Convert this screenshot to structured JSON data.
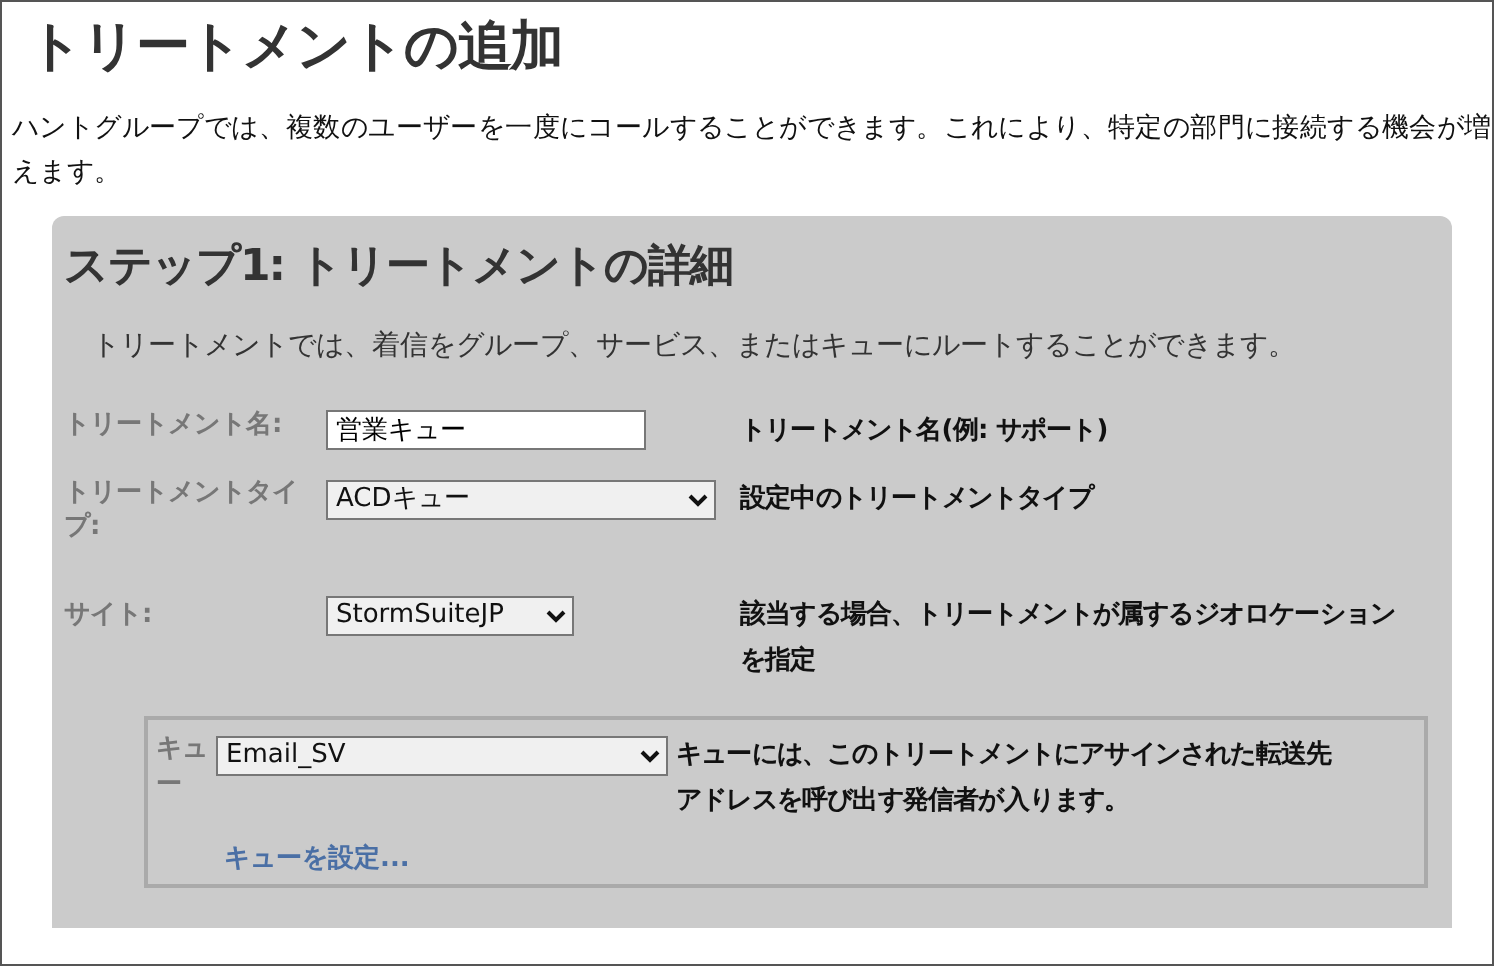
{
  "page_title": "トリートメントの追加",
  "intro": "ハントグループでは、複数のユーザーを一度にコールすることができます。これにより、特定の部門に接続する機会が増えます。",
  "step": {
    "title": "ステップ1: トリートメントの詳細",
    "description": "トリートメントでは、着信をグループ、サービス、またはキューにルートすることができます。",
    "fields": [
      {
        "kind": "text",
        "label": "トリートメント名:",
        "value": "営業キュー",
        "help": "トリートメント名(例: サポート)"
      },
      {
        "kind": "select",
        "label": "トリートメントタイプ:",
        "value": "ACDキュー",
        "help": "設定中のトリートメントタイプ"
      },
      {
        "kind": "select",
        "label": "サイト:",
        "value": "StormSuiteJP",
        "help": "該当する場合、トリートメントが属するジオロケーションを指定"
      }
    ],
    "queue": {
      "label": "キュー",
      "value": "Email_SV",
      "help": "キューには、このトリートメントにアサインされた転送先アドレスを呼び出す発信者が入ります。",
      "link": "キューを設定..."
    }
  }
}
